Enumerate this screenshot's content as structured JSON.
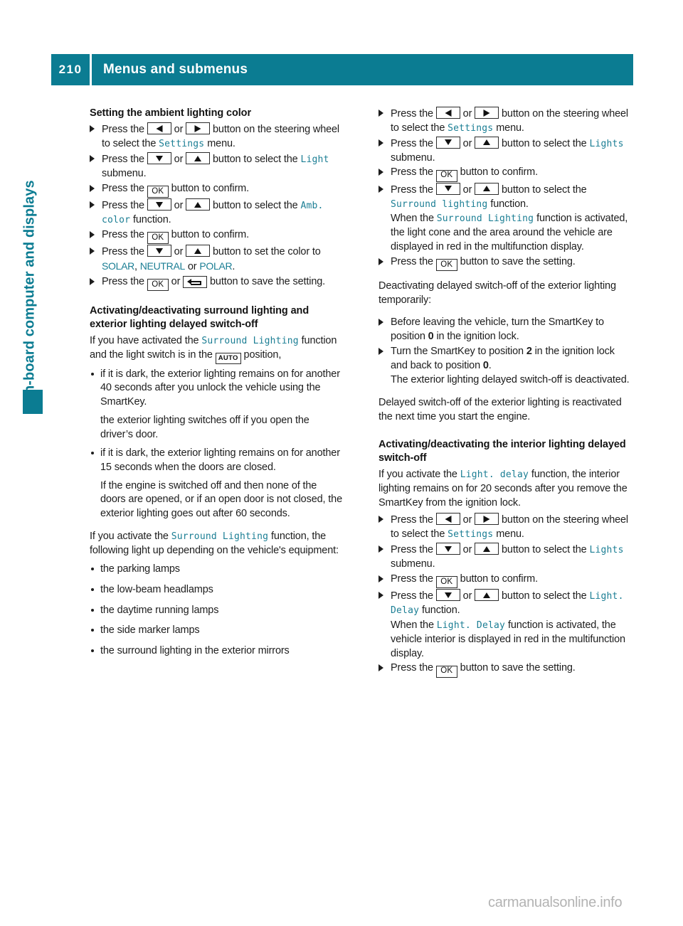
{
  "header": {
    "page_number": "210",
    "title": "Menus and submenus"
  },
  "side_tab": {
    "chapter_label": "On-board computer and displays"
  },
  "colors": {
    "accent_teal": "#0b7c92",
    "ui_term_teal": "#1b7e94",
    "body_text": "#1d1d1d",
    "watermark_gray": "#b3b3b3"
  },
  "keys": {
    "left": "left-arrow-key",
    "right": "right-arrow-key",
    "down": "down-arrow-key",
    "up": "up-arrow-key",
    "ok": "OK",
    "back": "back-arrow-key",
    "auto": "AUTO"
  },
  "left_column": {
    "heading_1": "Setting the ambient lighting color",
    "steps_1": {
      "s1_a": "Press the ",
      "s1_or": " or ",
      "s1_b": " button on the steering wheel to select the ",
      "s1_term": "Settings",
      "s1_c": " menu.",
      "s2_a": "Press the ",
      "s2_or": " or ",
      "s2_b": " button to select the ",
      "s2_term": "Light",
      "s2_c": " submenu.",
      "s3_a": "Press the ",
      "s3_b": " button to confirm.",
      "s4_a": "Press the ",
      "s4_or": " or ",
      "s4_b": " button to select the ",
      "s4_term": "Amb. color",
      "s4_c": " function.",
      "s5_a": "Press the ",
      "s5_b": " button to confirm.",
      "s6_a": "Press the ",
      "s6_or": " or ",
      "s6_b": " button to set the color to ",
      "s6_t1": "SOLAR",
      "s6_sep1": ", ",
      "s6_t2": "NEUTRAL",
      "s6_sep2": " or ",
      "s6_t3": "POLAR",
      "s6_c": ".",
      "s7_a": "Press the ",
      "s7_or": " or ",
      "s7_b": " button to save the setting."
    },
    "heading_2": "Activating/deactivating surround lighting and exterior lighting delayed switch-off",
    "intro": {
      "p1_a": "If you have activated the ",
      "p1_term": "Surround Lighting",
      "p1_b": " function and the light switch is in the ",
      "p1_c": " position,"
    },
    "bullets_1": [
      {
        "text": "if it is dark, the exterior lighting remains on for another 40 seconds after you unlock the vehicle using the SmartKey.",
        "follow": "the exterior lighting switches off if you open the driver’s door."
      },
      {
        "text": "if it is dark, the exterior lighting remains on for another 15 seconds when the doors are closed.",
        "follow": "If the engine is switched off and then none of the doors are opened, or if an open door is not closed, the exterior lighting goes out after 60 seconds."
      }
    ],
    "para_2": {
      "a": "If you activate the ",
      "term": "Surround Lighting",
      "b": " function, the following light up depending on the vehicle's equipment:"
    },
    "bullets_2": [
      "the parking lamps",
      "the low-beam headlamps",
      "the daytime running lamps",
      "the side marker lamps",
      "the surround lighting in the exterior mirrors"
    ]
  },
  "right_column": {
    "steps_1": {
      "s1_a": "Press the ",
      "s1_or": " or ",
      "s1_b": " button on the steering wheel to select the ",
      "s1_term": "Settings",
      "s1_c": " menu.",
      "s2_a": "Press the ",
      "s2_or": " or ",
      "s2_b": " button to select the ",
      "s2_term": "Lights",
      "s2_c": " submenu.",
      "s3_a": "Press the ",
      "s3_b": " button to confirm.",
      "s4_a": "Press the ",
      "s4_or": " or ",
      "s4_b": " button to select the ",
      "s4_term": "Surround lighting",
      "s4_c": " function.",
      "s4_note_a": "When the ",
      "s4_note_term": "Surround Lighting",
      "s4_note_b": " function is activated, the light cone and the area around the vehicle are displayed in red in the multifunction display.",
      "s5_a": "Press the ",
      "s5_b": " button to save the setting."
    },
    "para_deactivate": "Deactivating delayed switch-off of the exterior lighting temporarily:",
    "steps_2": {
      "s1_a": "Before leaving the vehicle, turn the SmartKey to position ",
      "s1_bold": "0",
      "s1_b": " in the ignition lock.",
      "s2_a": "Turn the SmartKey to position ",
      "s2_bold1": "2",
      "s2_b": " in the ignition lock and back to position ",
      "s2_bold2": "0",
      "s2_c": ".",
      "s2_note": "The exterior lighting delayed switch-off is deactivated."
    },
    "para_reactivated": "Delayed switch-off of the exterior lighting is reactivated the next time you start the engine.",
    "heading_interior": "Activating/deactivating the interior lighting delayed switch-off",
    "para_interior": {
      "a": "If you activate the ",
      "term": "Light. delay",
      "b": " function, the interior lighting remains on for 20 seconds after you remove the SmartKey from the ignition lock."
    },
    "steps_3": {
      "s1_a": "Press the ",
      "s1_or": " or ",
      "s1_b": " button on the steering wheel to select the ",
      "s1_term": "Settings",
      "s1_c": " menu.",
      "s2_a": "Press the ",
      "s2_or": " or ",
      "s2_b": " button to select the ",
      "s2_term": "Lights",
      "s2_c": " submenu.",
      "s3_a": "Press the ",
      "s3_b": " button to confirm.",
      "s4_a": "Press the ",
      "s4_or": " or ",
      "s4_b": " button to select the ",
      "s4_term": "Light. Delay",
      "s4_c": " function.",
      "s4_note_a": "When the ",
      "s4_note_term": "Light. Delay",
      "s4_note_b": " function is activated, the vehicle interior is displayed in red in the multifunction display.",
      "s5_a": "Press the ",
      "s5_b": " button to save the setting."
    }
  },
  "footer": {
    "watermark": "carmanualsonline.info"
  }
}
